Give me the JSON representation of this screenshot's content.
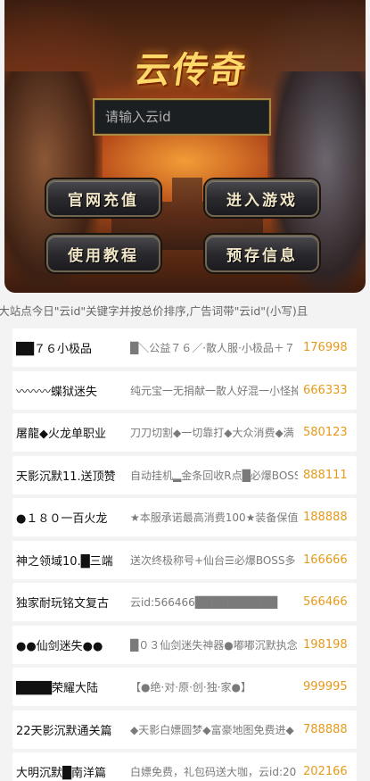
{
  "banner": {
    "logo_text": "云传奇",
    "search_placeholder": "请输入云id",
    "buttons": {
      "recharge": "官网充值",
      "enter_game": "进入游戏",
      "tutorial": "使用教程",
      "presave": "预存信息"
    }
  },
  "ticker": {
    "text": "§大站点今日\"云id\"关键字并按总价排序,广告词带\"云id\"(小写)且"
  },
  "servers": [
    {
      "name": "██７６小极品",
      "desc": "█＼公益７６／·散人服·小极品＋７",
      "num": "176998"
    },
    {
      "name": "〰〰〰蝶狱迷失",
      "desc": "纯元宝一无捐献一散人好混一小怪掉",
      "num": "666333"
    },
    {
      "name": "屠龍◆火龙单职业",
      "desc": "刀刀切割◆一切靠打◆大众消费◆满",
      "num": "580123"
    },
    {
      "name": "天影沉默11.送顶赞",
      "desc": "自动挂机▂金条回收R点█必爆BOSS",
      "num": "888111"
    },
    {
      "name": "●１８０一百火龙",
      "desc": "★本服承诺最高消费100★装备保值",
      "num": "188888"
    },
    {
      "name": "神之领域10.█三端",
      "desc": "送次终极称号+仙台☰必爆BOSS多",
      "num": "166666"
    },
    {
      "name": "独家耐玩铭文复古",
      "desc": "云id:566466██████████",
      "num": "566466"
    },
    {
      "name": "●●仙剑迷失●●",
      "desc": "█０３仙剑迷失神器●嘟嘟沉默执念",
      "num": "198198"
    },
    {
      "name": "████荣耀大陆",
      "desc": "【●绝·对·原·创·独·家●】",
      "num": "999995"
    },
    {
      "name": "22天影沉默通关篇",
      "desc": "◆天影白嫖圆梦◆富豪地图免费进◆",
      "num": "788888"
    },
    {
      "name": "大明沉默█南洋篇",
      "desc": "白嫖免费，礼包码送大咖，云id:20",
      "num": "202166"
    }
  ]
}
